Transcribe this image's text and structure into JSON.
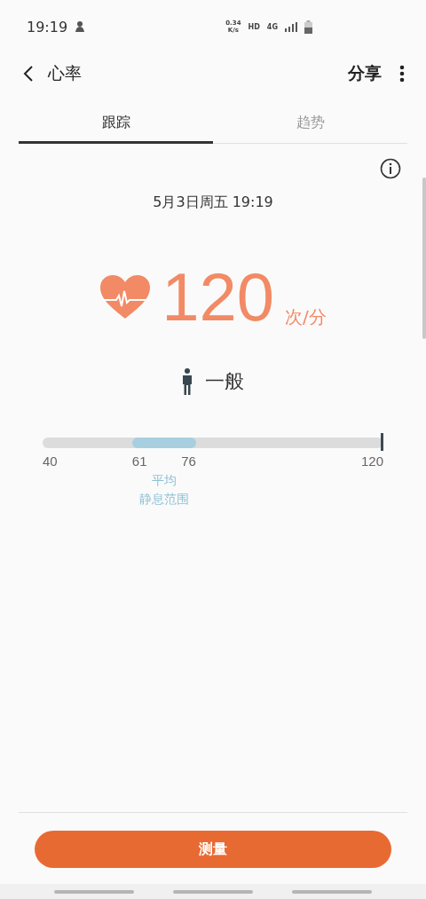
{
  "status_bar": {
    "time": "19:19",
    "speed": "0.34",
    "speed_unit": "K/s",
    "hd": "HD",
    "network": "4G"
  },
  "header": {
    "title": "心率",
    "share": "分享"
  },
  "tabs": [
    {
      "label": "跟踪",
      "selected": true
    },
    {
      "label": "趋势",
      "selected": false
    }
  ],
  "date": "5月3日周五 19:19",
  "reading": {
    "value": "120",
    "unit": "次/分"
  },
  "status": {
    "label": "一般"
  },
  "scale": {
    "labels": [
      "40",
      "61",
      "76",
      "120"
    ],
    "band": {
      "caption": [
        "平均",
        "静息范围"
      ]
    },
    "marker": {
      "level": 1
    }
  },
  "measure_button": "测量"
}
